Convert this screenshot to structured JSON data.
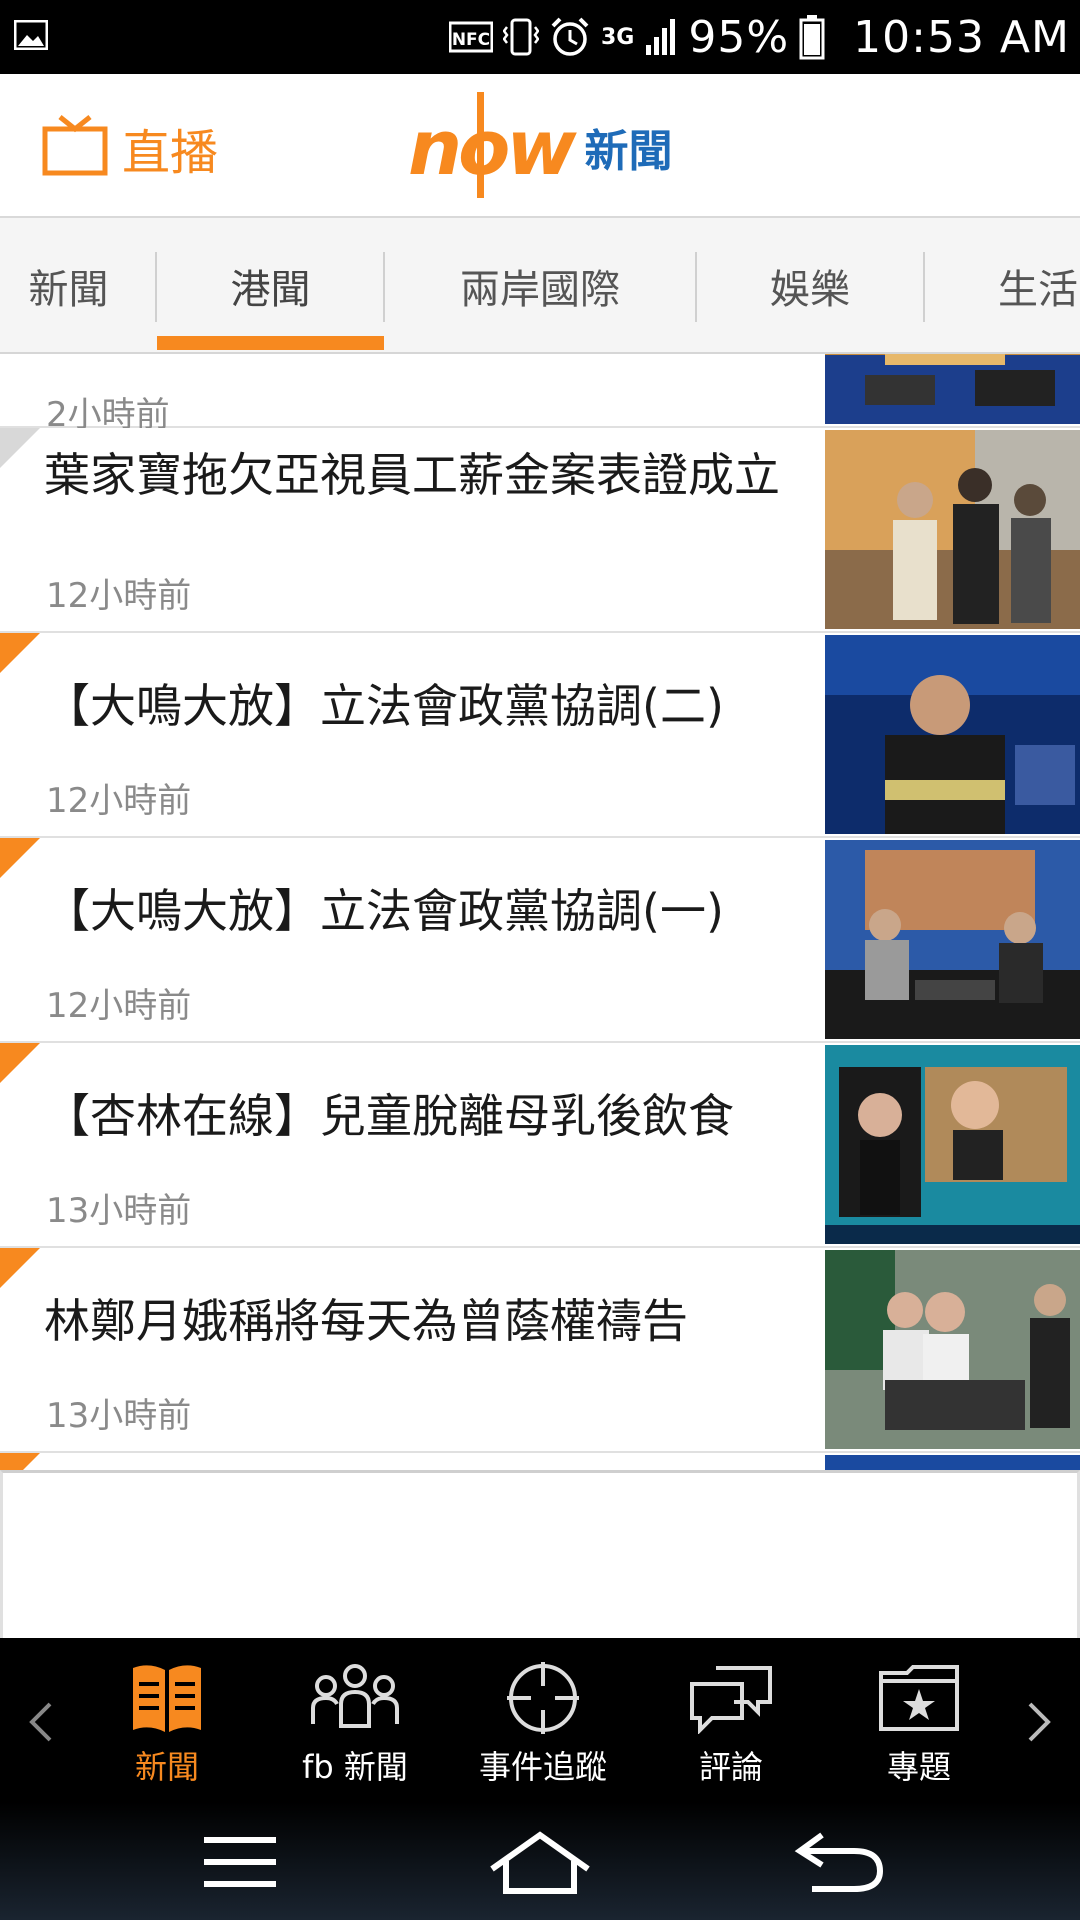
{
  "status_bar": {
    "nfc": "NFC",
    "network": "3G",
    "battery": "95%",
    "time": "10:53 AM"
  },
  "header": {
    "live_label": "直播",
    "logo_brand": "now",
    "logo_text": "新聞"
  },
  "tabs": [
    "新聞",
    "港聞",
    "兩岸國際",
    "娛樂",
    "生活"
  ],
  "active_tab": "港聞",
  "articles": [
    {
      "title": "",
      "time": "2小時前",
      "accent": "grey"
    },
    {
      "title": "葉家寶拖欠亞視員工薪金案表證成立",
      "time": "12小時前",
      "accent": "grey"
    },
    {
      "title": "【大鳴大放】立法會政黨協調(二)",
      "time": "12小時前",
      "accent": "orange"
    },
    {
      "title": "【大鳴大放】立法會政黨協調(一)",
      "time": "12小時前",
      "accent": "orange"
    },
    {
      "title": "【杏林在線】兒童脫離母乳後飲食",
      "time": "13小時前",
      "accent": "orange"
    },
    {
      "title": "林鄭月娥稱將每天為曾蔭權禱告",
      "time": "13小時前",
      "accent": "orange"
    }
  ],
  "bottom_nav": [
    {
      "label": "新聞",
      "icon": "book-icon",
      "active": true
    },
    {
      "label": "fb 新聞",
      "icon": "people-icon",
      "active": false
    },
    {
      "label": "事件追蹤",
      "icon": "crosshair-icon",
      "active": false
    },
    {
      "label": "評論",
      "icon": "chat-bubbles-icon",
      "active": false
    },
    {
      "label": "專題",
      "icon": "star-folder-icon",
      "active": false
    }
  ],
  "colors": {
    "accent": "#f7891f",
    "brand_blue": "#1e6bb8"
  }
}
